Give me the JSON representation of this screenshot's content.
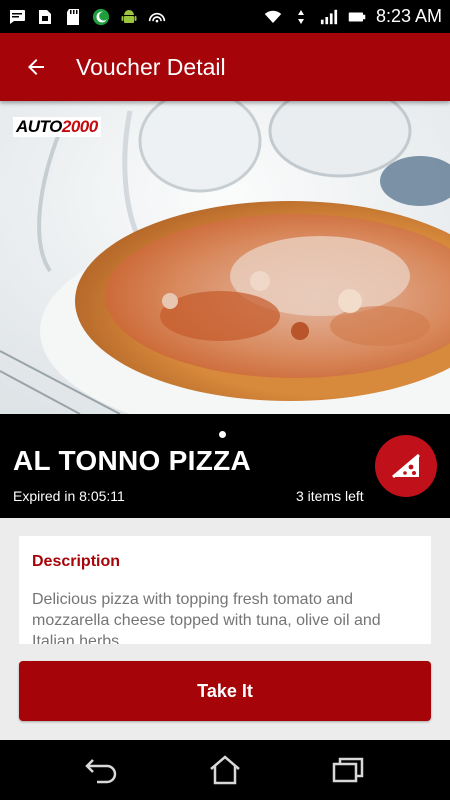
{
  "status_bar": {
    "time": "8:23 AM",
    "icons": [
      "chat-icon",
      "sim-card-icon",
      "sd-card-icon",
      "crescent-moon-icon",
      "android-icon",
      "hotspot-icon",
      "wifi-icon",
      "data-arrows-icon",
      "signal-icon",
      "battery-icon"
    ]
  },
  "app_bar": {
    "title": "Voucher Detail",
    "back_icon": "arrow-back-icon",
    "color": "#a50509"
  },
  "hero": {
    "logo_auto": "AUTO",
    "logo_number": "2000",
    "image": "pizza-photo"
  },
  "voucher": {
    "title": "AL TONNO PIZZA",
    "expired_text": "Expired in 8:05:11",
    "items_left_text": "3 items left",
    "badge_icon": "pizza-slice-icon",
    "badge_color": "#c0101a"
  },
  "description": {
    "heading": "Description",
    "text": "Delicious pizza with topping fresh tomato and mozzarella cheese topped with tuna, olive oil and Italian herbs."
  },
  "actions": {
    "take_label": "Take It"
  },
  "nav_bar": {
    "icons": [
      "back-nav-icon",
      "home-icon",
      "recent-apps-icon"
    ]
  }
}
